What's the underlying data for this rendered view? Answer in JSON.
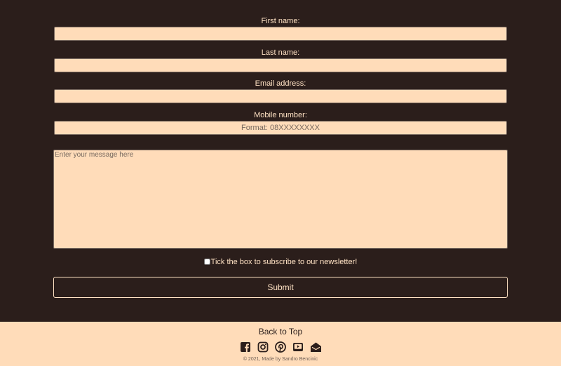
{
  "form": {
    "first_name_label": "First name:",
    "first_name_value": "",
    "last_name_label": "Last name:",
    "last_name_value": "",
    "email_label": "Email address:",
    "email_value": "",
    "mobile_label": "Mobile number:",
    "mobile_placeholder": "Format: 08XXXXXXXX",
    "message_placeholder": "Enter your message here",
    "newsletter_label": "Tick the box to subscribe to our newsletter!",
    "submit_label": "Submit"
  },
  "footer": {
    "back_to_top": "Back to Top",
    "social_icons": [
      "facebook-icon",
      "instagram-icon",
      "pinterest-icon",
      "youtube-icon",
      "email-icon"
    ],
    "copyright": "© 2021, Made by Sandro Bencinic"
  },
  "colors": {
    "background": "#2b1e1b",
    "field": "#ffdcb9",
    "accent": "#ffe2c4"
  }
}
